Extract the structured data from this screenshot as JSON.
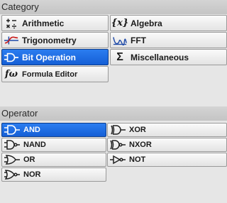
{
  "category": {
    "header": "Category",
    "items": [
      {
        "label": "Arithmetic",
        "icon": "arithmetic-icon"
      },
      {
        "label": "Algebra",
        "icon": "algebra-icon"
      },
      {
        "label": "Trigonometry",
        "icon": "trig-wave-icon"
      },
      {
        "label": "FFT",
        "icon": "fft-icon"
      },
      {
        "label": "Bit Operation",
        "icon": "logic-gate-icon",
        "selected": true
      },
      {
        "label": "Miscellaneous",
        "icon": "sigma-icon"
      },
      {
        "label": "Formula Editor",
        "icon": "formula-icon"
      }
    ],
    "algebra_glyph": "{x}",
    "sigma_glyph": "Σ",
    "formula_glyph": "fω"
  },
  "operator": {
    "header": "Operator",
    "items": [
      {
        "label": "AND",
        "icon": "and-gate-icon",
        "selected": true
      },
      {
        "label": "XOR",
        "icon": "xor-gate-icon"
      },
      {
        "label": "NAND",
        "icon": "nand-gate-icon"
      },
      {
        "label": "NXOR",
        "icon": "nxor-gate-icon"
      },
      {
        "label": "OR",
        "icon": "or-gate-icon"
      },
      {
        "label": "NOT",
        "icon": "not-gate-icon"
      },
      {
        "label": "NOR",
        "icon": "nor-gate-icon"
      }
    ]
  },
  "colors": {
    "selected": "#1f6fe6",
    "background": "#e6e6e6"
  }
}
